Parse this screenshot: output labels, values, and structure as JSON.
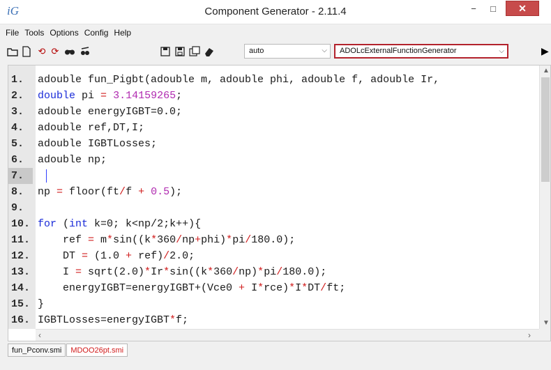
{
  "window": {
    "app_icon": "iG",
    "title": "Component Generator - 2.11.4",
    "minimize": "−",
    "maximize": "□",
    "close": "✕"
  },
  "menu": [
    "File",
    "Tools",
    "Options",
    "Config",
    "Help"
  ],
  "toolbar": {
    "icons": [
      "open-folder-icon",
      "new-file-icon",
      "undo-icon",
      "redo-icon",
      "find-icon",
      "find-replace-icon",
      "save-icon",
      "save-as-icon",
      "save-all-icon",
      "eraser-icon"
    ],
    "mode_select": "auto",
    "generator_select": "ADOLcExternalFunctionGenerator",
    "run_icon": "play-icon"
  },
  "editor": {
    "lines": [
      "adouble fun_Pigbt(adouble m, adouble phi, adouble f, adouble Ir,",
      "double pi = 3.14159265;",
      "adouble energyIGBT=0.0;",
      "adouble ref,DT,I;",
      "adouble IGBTLosses;",
      "adouble np;",
      "",
      "np = floor(ft/f + 0.5);",
      "",
      "for (int k=0; k<np/2;k++){",
      "    ref = m*sin((k*360/np+phi)*pi/180.0);",
      "    DT = (1.0 + ref)/2.0;",
      "    I = sqrt(2.0)*Ir*sin((k*360/np)*pi/180.0);",
      "    energyIGBT=energyIGBT+(Vce0 + I*rce)*I*DT/ft;",
      "}",
      "IGBTLosses=energyIGBT*f;"
    ],
    "line_numbers": [
      "1.",
      "2.",
      "3.",
      "4.",
      "5.",
      "6.",
      "7.",
      "8.",
      "9.",
      "10.",
      "11.",
      "12.",
      "13.",
      "14.",
      "15.",
      "16."
    ],
    "current_line": 7
  },
  "tabs": [
    "fun_Pconv.smi",
    "MDOO26pt.smi"
  ],
  "colors": {
    "keyword": "#1a2bd8",
    "number": "#b02ab0",
    "operator": "#d01d1d",
    "highlight_border": "#b3222c"
  }
}
